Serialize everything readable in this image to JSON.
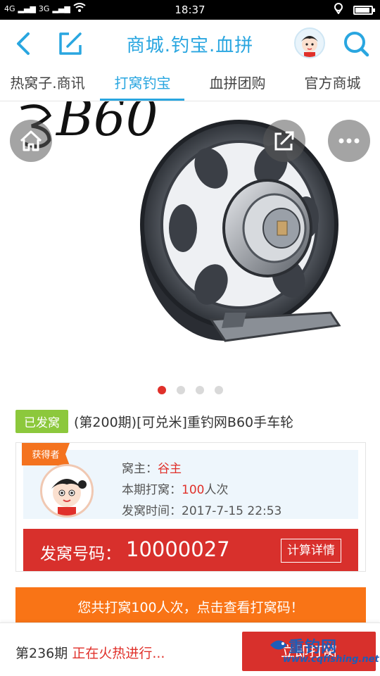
{
  "status_bar": {
    "network_left": "4G",
    "network_right": "3G",
    "time": "18:37"
  },
  "header": {
    "title": "商城.钓宝.血拼"
  },
  "tabs": [
    {
      "label": "热窝子.商讯"
    },
    {
      "label": "打窝钓宝"
    },
    {
      "label": "血拼团购"
    },
    {
      "label": "官方商城"
    }
  ],
  "carousel": {
    "image_text": "B60",
    "dots_total": 4,
    "active_index": 0
  },
  "product": {
    "badge": "已发窝",
    "title": "(第200期)[可兑米]重钓网B60手车轮"
  },
  "winner": {
    "ribbon": "获得者",
    "owner_label": "窝主：",
    "owner_value": "谷主",
    "period_label": "本期打窝：",
    "period_count": "100",
    "period_unit": "人次",
    "time_label": "发窝时间：",
    "time_value": "2017-7-15 22:53",
    "draw_label": "发窝号码：",
    "draw_value": "10000027",
    "calc_button": "计算详情"
  },
  "notice": "您共打窝100人次，点击查看打窝码！",
  "bottom": {
    "period": "第236期",
    "status": "正在火热进行...",
    "button": "立即打窝",
    "watermark_title": "重钓网",
    "watermark_url": "www.cqfishing.net"
  },
  "colors": {
    "accent": "#29a6e0",
    "red": "#d8302c",
    "green_badge": "#8cc83c",
    "orange": "#f97416"
  }
}
